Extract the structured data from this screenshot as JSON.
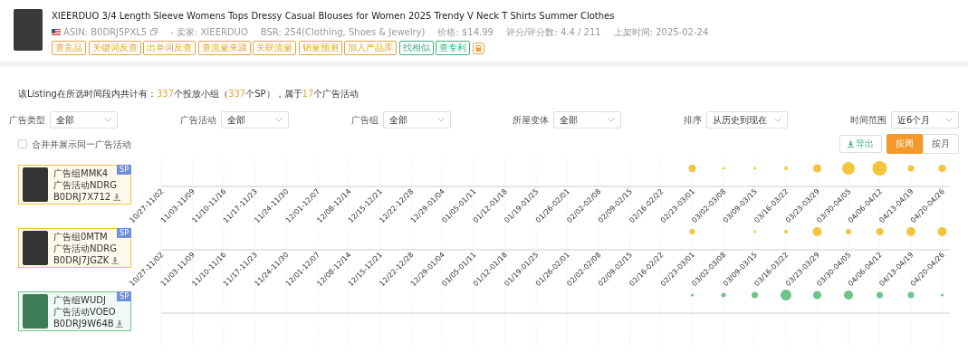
{
  "product": {
    "title": "XIEERDUO 3/4 Length Sleeve Womens Tops Dressy Casual Blouses for Women 2025 Trendy V Neck T Shirts Summer Clothes",
    "meta": [
      "ASIN: B0DRJ5PXL5",
      "- 卖家: XIEERDUO",
      "BSR: 254(Clothing, Shoes & Jewelry)",
      "价格: $14.99",
      "评分/评分数: 4.4 / 211",
      "上架时间: 2025-02-24"
    ],
    "tags": [
      {
        "label": "查竞品",
        "color": "#e8a33d"
      },
      {
        "label": "关键词反查",
        "color": "#e8a33d"
      },
      {
        "label": "出单词反查",
        "color": "#e8a33d"
      },
      {
        "label": "查流量来源",
        "color": "#e8a33d"
      },
      {
        "label": "关联流量",
        "color": "#e8a33d"
      },
      {
        "label": "销量预测",
        "color": "#e8a33d"
      },
      {
        "label": "加入产品库",
        "color": "#e8a33d"
      },
      {
        "label": "找相似",
        "color": "#3fb37f"
      },
      {
        "label": "查专利",
        "color": "#3fb37f"
      }
    ]
  },
  "summary": [
    {
      "text": "该Listing在所选时间段内共计有：",
      "highlight": false
    },
    {
      "text": "337",
      "highlight": true
    },
    {
      "text": "个投放小组（",
      "highlight": false
    },
    {
      "text": "337",
      "highlight": true
    },
    {
      "text": "个SP），属于",
      "highlight": false
    },
    {
      "text": "17",
      "highlight": true
    },
    {
      "text": "个广告活动",
      "highlight": false
    }
  ],
  "filters": [
    {
      "label": "广告类型",
      "value": "全部"
    },
    {
      "label": "广告活动",
      "value": "全部"
    },
    {
      "label": "广告组",
      "value": "全部"
    },
    {
      "label": "所屋变体",
      "value": "全部"
    },
    {
      "label": "排序",
      "value": "从历史到现在"
    },
    {
      "label": "时间范围",
      "value": "近6个月"
    }
  ],
  "merge_option": {
    "label": "合并并展示同一广告活动",
    "checked": false
  },
  "export_button": "导出",
  "period_tabs": [
    {
      "label": "按周",
      "selected": true
    },
    {
      "label": "按月",
      "selected": false
    }
  ],
  "groups": [
    {
      "name": "广告组MMK4",
      "campaign": "广告活动NDRG",
      "asin": "B0DRJ7X712",
      "badge": "SP",
      "color": "#f2c53d",
      "axis_labels": [
        "10/27-11/02",
        "11/03-11/09",
        "11/10-11/16",
        "11/17-11/23",
        "11/24-11/30",
        "12/01-12/07",
        "12/08-12/14",
        "12/15-12/21",
        "12/22-12/28",
        "12/29-01/04",
        "01/05-01/11",
        "01/12-01/18",
        "01/19-01/25",
        "01/26-02/01",
        "02/02-02/08",
        "02/09-02/15",
        "02/16-02/22",
        "02/23-03/01",
        "03/02-03/08",
        "03/09-03/15",
        "03/16-03/22",
        "03/23-03/29",
        "03/30-04/05",
        "04/06-04/12",
        "04/13-04/19",
        "04/20-04/26"
      ]
    },
    {
      "name": "广告组0MTM",
      "campaign": "广告活动NDRG",
      "asin": "B0DRJ7JGZK",
      "badge": "SP",
      "color": "#f2c53d",
      "axis_labels": [
        "10/27-11/02",
        "11/03-11/09",
        "11/10-11/16",
        "11/17-11/23",
        "11/24-11/30",
        "12/01-12/07",
        "12/08-12/14",
        "12/15-12/21",
        "12/22-12/28",
        "12/29-01/04",
        "01/05-01/11",
        "01/12-01/18",
        "01/19-01/25",
        "01/26-02/01",
        "02/02-02/08",
        "02/09-02/15",
        "02/16-02/22",
        "02/23-03/01",
        "03/02-03/08",
        "03/09-03/15",
        "03/16-03/22",
        "03/23-03/29",
        "03/30-04/05",
        "04/06-04/12",
        "04/13-04/19",
        "04/20-04/26"
      ]
    },
    {
      "name": "广告组WUDJ",
      "campaign": "广告活动VOEO",
      "asin": "B0DRJ9W64B",
      "badge": "SP",
      "color": "#6cc488"
    }
  ]
}
